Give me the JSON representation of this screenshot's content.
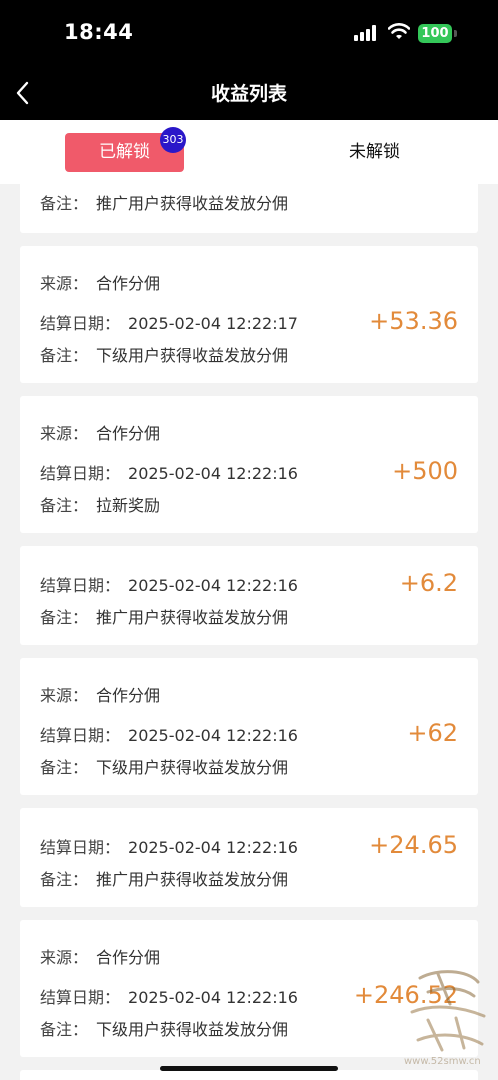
{
  "status": {
    "time": "18:44",
    "battery": "100"
  },
  "nav": {
    "title": "收益列表"
  },
  "tabs": {
    "active": "已解锁",
    "badge": "303",
    "inactive": "未解锁"
  },
  "labels": {
    "source": "来源：",
    "date": "结算日期：",
    "note": "备注："
  },
  "records": [
    {
      "source": null,
      "date": null,
      "note": "推广用户获得收益发放分佣",
      "amount": null
    },
    {
      "source": "合作分佣",
      "date": "2025-02-04 12:22:17",
      "note": "下级用户获得收益发放分佣",
      "amount": "+53.36"
    },
    {
      "source": "合作分佣",
      "date": "2025-02-04 12:22:16",
      "note": "拉新奖励",
      "amount": "+500"
    },
    {
      "source": null,
      "date": "2025-02-04 12:22:16",
      "note": "推广用户获得收益发放分佣",
      "amount": "+6.2"
    },
    {
      "source": "合作分佣",
      "date": "2025-02-04 12:22:16",
      "note": "下级用户获得收益发放分佣",
      "amount": "+62"
    },
    {
      "source": null,
      "date": "2025-02-04 12:22:16",
      "note": "推广用户获得收益发放分佣",
      "amount": "+24.65"
    },
    {
      "source": "合作分佣",
      "date": "2025-02-04 12:22:16",
      "note": "下级用户获得收益发放分佣",
      "amount": "+246.52"
    }
  ],
  "watermark": {
    "text": "www.52smw.cn"
  },
  "colors": {
    "accent": "#f05a6a",
    "amount": "#e28a3a",
    "badge": "#2a17c9",
    "battery": "#34c759"
  }
}
